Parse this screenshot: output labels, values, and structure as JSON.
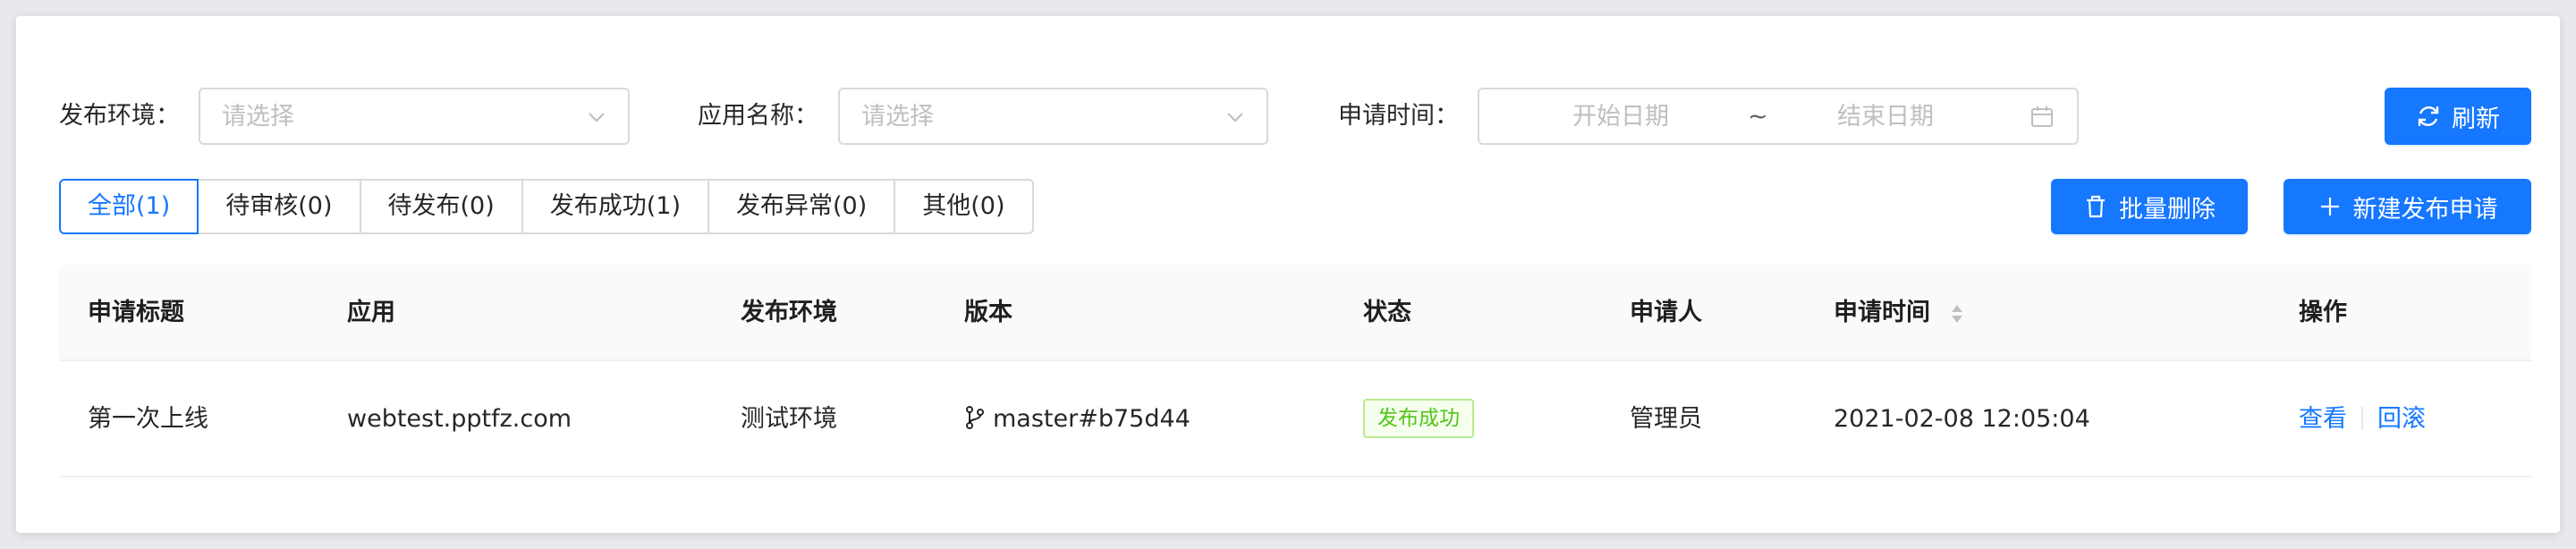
{
  "filters": {
    "env_label": "发布环境：",
    "env_placeholder": "请选择",
    "app_label": "应用名称：",
    "app_placeholder": "请选择",
    "time_label": "申请时间：",
    "start_placeholder": "开始日期",
    "range_separator": "~",
    "end_placeholder": "结束日期",
    "refresh_label": "刷新"
  },
  "tabs": [
    {
      "label": "全部(1)",
      "active": true
    },
    {
      "label": "待审核(0)",
      "active": false
    },
    {
      "label": "待发布(0)",
      "active": false
    },
    {
      "label": "发布成功(1)",
      "active": false
    },
    {
      "label": "发布异常(0)",
      "active": false
    },
    {
      "label": "其他(0)",
      "active": false
    }
  ],
  "actions": {
    "batch_delete_label": "批量删除",
    "new_request_label": "新建发布申请"
  },
  "table": {
    "columns": [
      "申请标题",
      "应用",
      "发布环境",
      "版本",
      "状态",
      "申请人",
      "申请时间",
      "操作"
    ],
    "rows": [
      {
        "title": "第一次上线",
        "app": "webtest.pptfz.com",
        "env": "测试环境",
        "version": "master#b75d44",
        "status": "发布成功",
        "applicant": "管理员",
        "time": "2021-02-08 12:05:04",
        "view_label": "查看",
        "rollback_label": "回滚"
      }
    ]
  },
  "colors": {
    "primary": "#1677ff",
    "success_text": "#52c41a",
    "success_bg": "#f6ffed",
    "success_border": "#b7eb8f"
  },
  "icons": [
    "chevron-down-icon",
    "calendar-icon",
    "refresh-icon",
    "trash-icon",
    "plus-icon",
    "branch-icon",
    "sort-icon"
  ]
}
